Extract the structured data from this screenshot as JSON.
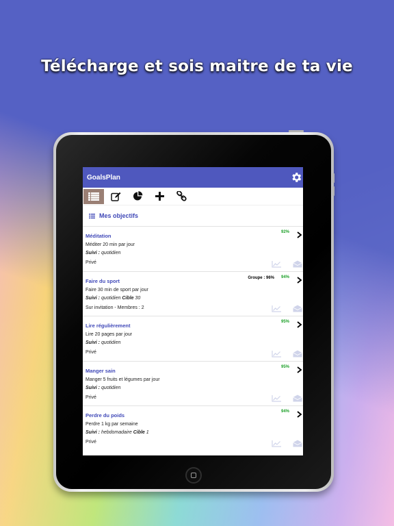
{
  "headline": "Télécharge et sois maitre de ta vie",
  "app": {
    "title": "GoalsPlan"
  },
  "toolbar": {
    "items": [
      {
        "icon": "list-icon",
        "active": true
      },
      {
        "icon": "edit-icon",
        "active": false
      },
      {
        "icon": "pie-chart-icon",
        "active": false
      },
      {
        "icon": "plus-icon",
        "active": false
      },
      {
        "icon": "link-icon",
        "active": false
      }
    ]
  },
  "section": {
    "title": "Mes objectifs"
  },
  "goals": [
    {
      "title": "Méditation",
      "description": "Méditer 20 min par jour",
      "track_label": "Suivi :",
      "track_value": "quotidien",
      "target_label": "",
      "target_value": "",
      "privacy": "Privé",
      "percent": "92%",
      "group": ""
    },
    {
      "title": "Faire du sport",
      "description": "Faire 30 min de sport par jour",
      "track_label": "Suivi :",
      "track_value": "quotidien",
      "target_label": "Cible",
      "target_value": "30",
      "privacy": "Sur invitation - Membres : 2",
      "percent": "94%",
      "group": "Groupe : 96%"
    },
    {
      "title": "Lire régulièrement",
      "description": "Lire 20 pages par jour",
      "track_label": "Suivi :",
      "track_value": "quotidien",
      "target_label": "",
      "target_value": "",
      "privacy": "Privé",
      "percent": "95%",
      "group": ""
    },
    {
      "title": "Manger sain",
      "description": "Manger 5 fruits et légumes par jour",
      "track_label": "Suivi :",
      "track_value": "quotidien",
      "target_label": "",
      "target_value": "",
      "privacy": "Privé",
      "percent": "95%",
      "group": ""
    },
    {
      "title": "Perdre du poids",
      "description": "Perdre 1 kg par semaine",
      "track_label": "Suivi :",
      "track_value": "hebdomadaire",
      "target_label": "Cible",
      "target_value": "1",
      "privacy": "Privé",
      "percent": "94%",
      "group": ""
    }
  ],
  "colors": {
    "accent": "#4f58be",
    "title_blue": "#4049b8",
    "percent_green": "#1ea12a",
    "toolbar_active": "#9a7f74",
    "background": "#5561c4"
  }
}
